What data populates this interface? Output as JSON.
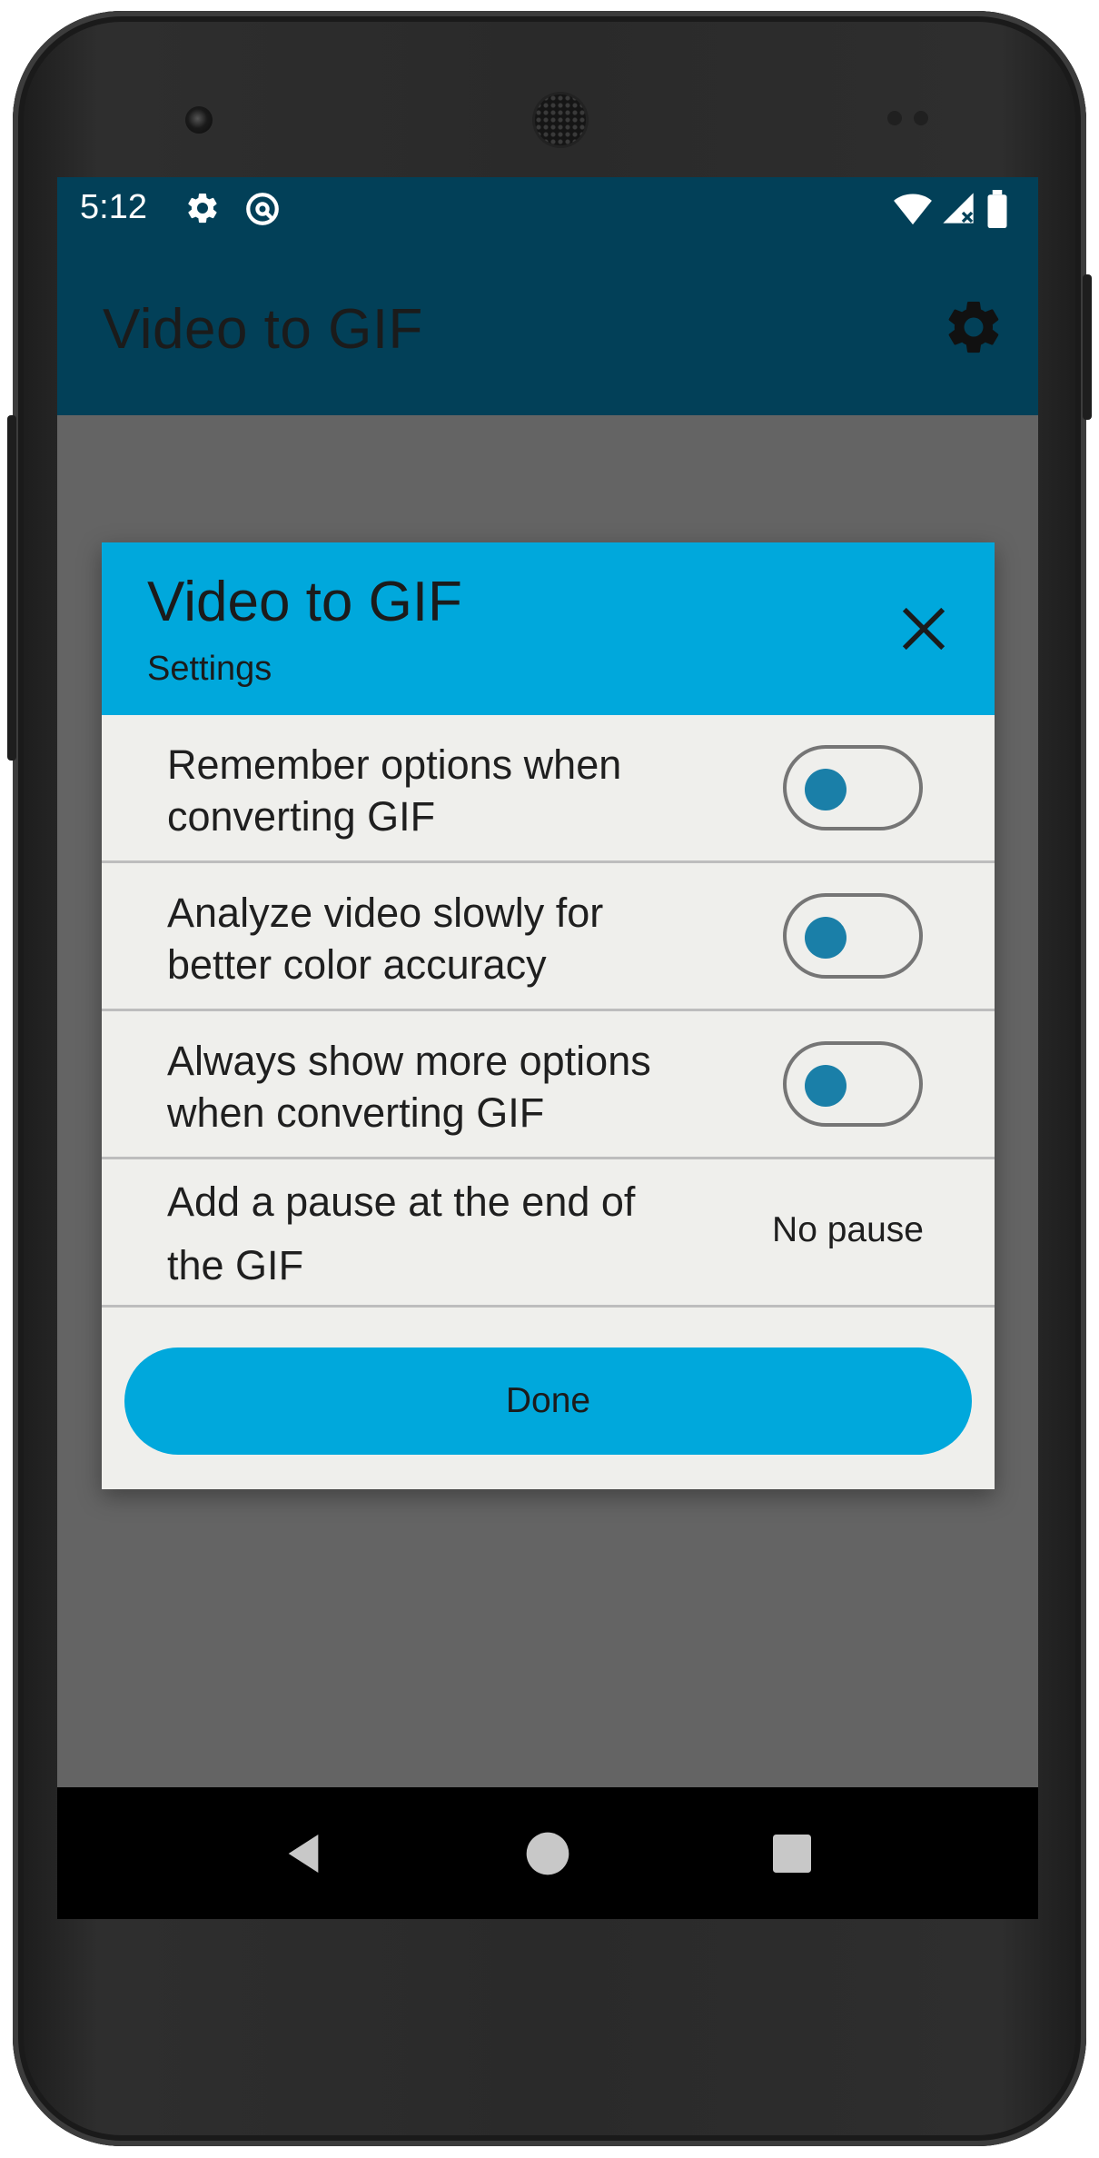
{
  "status_bar": {
    "time": "5:12",
    "icons": [
      "gear-icon",
      "at-sign-icon",
      "wifi-icon",
      "signal-icon",
      "battery-icon"
    ]
  },
  "app_bar": {
    "title": "Video to GIF",
    "action_icon": "gear-icon"
  },
  "dialog": {
    "title": "Video to GIF",
    "subtitle": "Settings",
    "close_icon": "close-icon",
    "settings": [
      {
        "label": "Remember options when converting GIF",
        "control": "toggle"
      },
      {
        "label": "Analyze video slowly for better color accuracy",
        "control": "toggle"
      },
      {
        "label": "Always show more options when converting GIF",
        "control": "toggle"
      },
      {
        "label": "Add a pause at the end of the GIF",
        "control": "value",
        "value": "No pause"
      }
    ],
    "done_label": "Done"
  },
  "nav_bar": {
    "icons": [
      "back-icon",
      "home-icon",
      "recents-icon"
    ]
  },
  "colors": {
    "app_bar": "#024058",
    "accent": "#00a8dc",
    "dialog_bg": "#efefec",
    "scrim": "#646464",
    "toggle_knob": "#1a7fa8"
  }
}
